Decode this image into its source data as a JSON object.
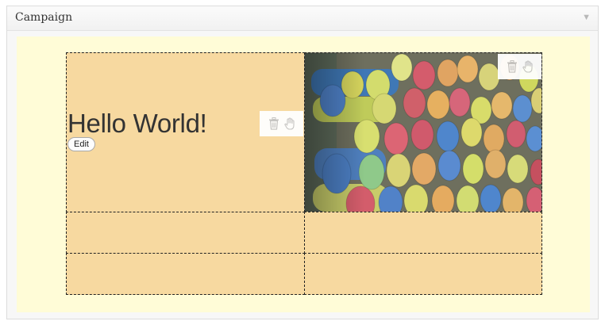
{
  "panel": {
    "title": "Campaign",
    "toggle": "▼"
  },
  "widget": {
    "heading": "Hello World!",
    "edit_label": "Edit"
  },
  "icons": {
    "delete": "trash-icon",
    "move": "hand-icon"
  },
  "colors": {
    "cell_fill": "#f7d9a0",
    "canvas_bg": "#fffcd7"
  }
}
